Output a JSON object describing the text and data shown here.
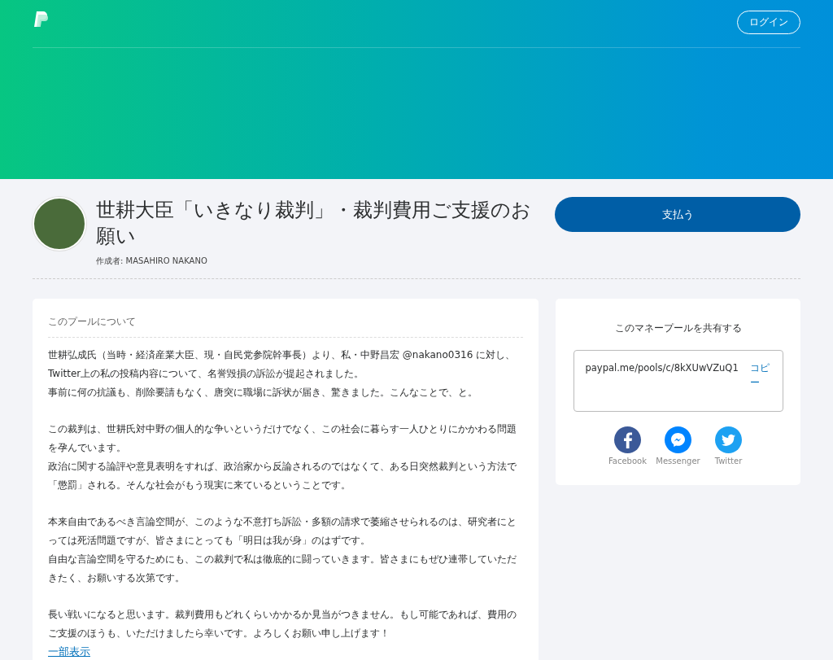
{
  "header": {
    "login_button": "ログイン"
  },
  "pool": {
    "title": "世耕大臣「いきなり裁判」・裁判費用ご支援のお願い",
    "creator": "作成者: MASAHIRO NAKANO",
    "pay_button": "支払う"
  },
  "about": {
    "heading": "このプールについて",
    "paragraphs": [
      [
        "世耕弘成氏（当時・経済産業大臣、現・自民党参院幹事長）より、私・中野昌宏 @nakano0316 に対し、Twitter上の私の投稿内容について、名誉毀損の訴訟が提起されました。",
        "事前に何の抗議も、削除要請もなく、唐突に職場に訴状が届き、驚きました。こんなことで、と。"
      ],
      [
        "この裁判は、世耕氏対中野の個人的な争いというだけでなく、この社会に暮らす一人ひとりにかかわる問題を孕んでいます。",
        "政治に関する論評や意見表明をすれば、政治家から反論されるのではなくて、ある日突然裁判という方法で「懲罰」される。そんな社会がもう現実に来ているということです。"
      ],
      [
        "本来自由であるべき言論空間が、このような不意打ち訴訟・多額の請求で萎縮させられるのは、研究者にとっては死活問題ですが、皆さまにとっても「明日は我が身」のはずです。",
        "自由な言論空間を守るためにも、この裁判で私は徹底的に闘っていきます。皆さまにもぜひ連帯していただきたく、お願いする次第です。"
      ],
      [
        "長い戦いになると思います。裁判費用もどれくらいかかるか見当がつきません。もし可能であれば、費用のご支援のほうも、いただけましたら幸いです。よろしくお願い申し上げます！"
      ]
    ],
    "show_less_link": "一部表示"
  },
  "share": {
    "heading": "このマネープールを共有する",
    "link": "paypal.me/pools/c/8kXUwVZuQ1",
    "copy_button": "コピー",
    "networks": [
      {
        "kind": "facebook",
        "label": "Facebook"
      },
      {
        "kind": "messenger",
        "label": "Messenger"
      },
      {
        "kind": "twitter",
        "label": "Twitter"
      }
    ]
  }
}
